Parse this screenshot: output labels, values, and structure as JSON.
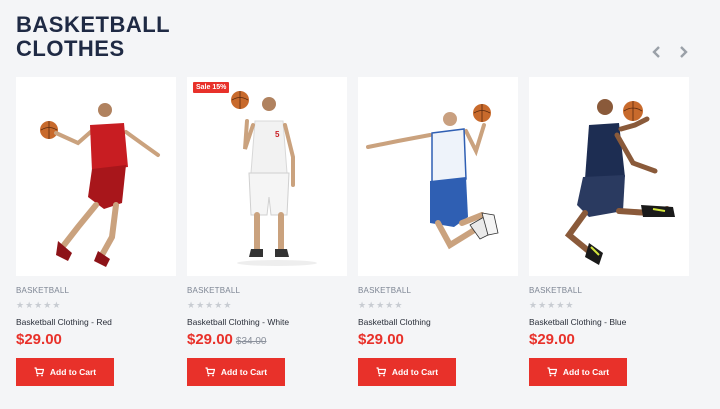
{
  "section": {
    "title": "BASKETBALL CLOTHES"
  },
  "nav": {
    "prev_icon": "chevron-left-icon",
    "next_icon": "chevron-right-icon"
  },
  "products": [
    {
      "category": "BASKETBALL",
      "name": "Basketball Clothing - Red",
      "price": "$29.00",
      "old_price": "",
      "badge": "",
      "rating": 0,
      "jersey_color": "#c81d22",
      "cart_label": "Add to Cart"
    },
    {
      "category": "BASKETBALL",
      "name": "Basketball Clothing - White",
      "price": "$29.00",
      "old_price": "$34.00",
      "badge": "Sale 15%",
      "rating": 0,
      "jersey_color": "#f2f2f2",
      "cart_label": "Add to Cart"
    },
    {
      "category": "BASKETBALL",
      "name": "Basketball Clothing",
      "price": "$29.00",
      "old_price": "",
      "badge": "",
      "rating": 0,
      "jersey_color": "#2f5fb3",
      "cart_label": "Add to Cart"
    },
    {
      "category": "BASKETBALL",
      "name": "Basketball Clothing - Blue",
      "price": "$29.00",
      "old_price": "",
      "badge": "",
      "rating": 0,
      "jersey_color": "#1d2d52",
      "cart_label": "Add to Cart"
    }
  ],
  "colors": {
    "accent": "#e8312a",
    "title": "#1f2a44"
  }
}
